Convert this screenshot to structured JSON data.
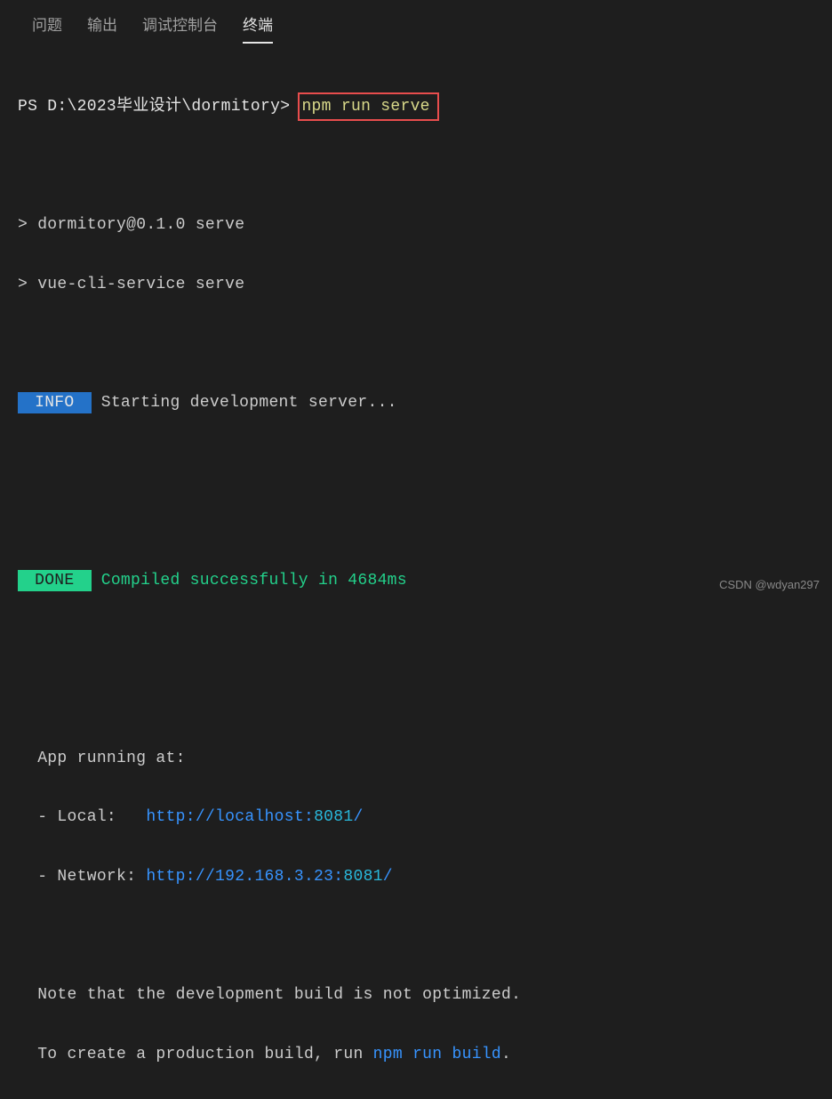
{
  "tabs": {
    "problems": "问题",
    "output": "输出",
    "debug_console": "调试控制台",
    "terminal": "终端"
  },
  "prompt": {
    "path": "PS D:\\2023毕业设计\\dormitory>",
    "command": "npm run serve"
  },
  "script_echo": {
    "line1": "> dormitory@0.1.0 serve",
    "line2": "> vue-cli-service serve"
  },
  "info": {
    "badge": " INFO ",
    "text": " Starting development server..."
  },
  "done": {
    "badge": " DONE ",
    "text": " Compiled successfully in 4684ms"
  },
  "app": {
    "running": "  App running at:",
    "local_label": "  - Local:   ",
    "local_url_prefix": "http://localhost:",
    "local_port": "8081",
    "local_suffix": "/",
    "network_label": "  - Network: ",
    "network_url_prefix": "http://192.168.3.23:",
    "network_port": "8081",
    "network_suffix": "/"
  },
  "note": {
    "line1": "  Note that the development build is not optimized.",
    "line2_prefix": "  To create a production build, run ",
    "line2_cmd": "npm run build",
    "line2_suffix": "."
  },
  "watermark": "CSDN @wdyan297"
}
